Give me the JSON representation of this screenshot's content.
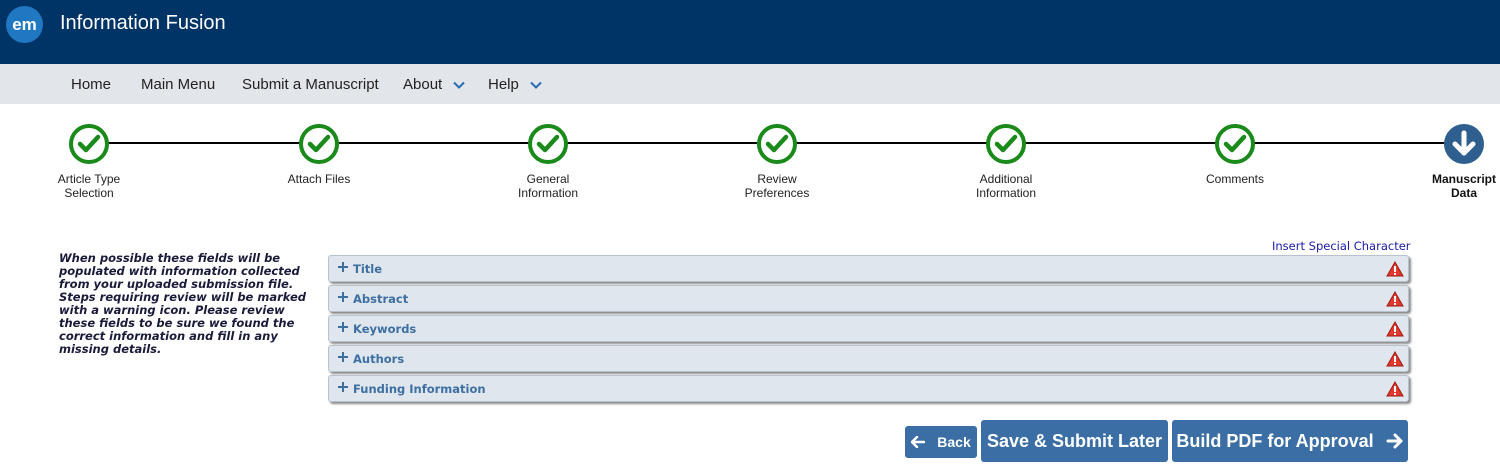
{
  "header": {
    "logo_text": "em",
    "title": "Information Fusion",
    "bg_color": "#003366"
  },
  "nav": {
    "items": [
      {
        "label": "Home",
        "dropdown": false
      },
      {
        "label": "Main Menu",
        "dropdown": false
      },
      {
        "label": "Submit a Manuscript",
        "dropdown": false
      },
      {
        "label": "About",
        "dropdown": true
      },
      {
        "label": "Help",
        "dropdown": true
      }
    ]
  },
  "steps": [
    {
      "line1": "Article Type",
      "line2": "Selection",
      "status": "complete"
    },
    {
      "line1": "Attach Files",
      "line2": "",
      "status": "complete"
    },
    {
      "line1": "General",
      "line2": "Information",
      "status": "complete"
    },
    {
      "line1": "Review",
      "line2": "Preferences",
      "status": "complete"
    },
    {
      "line1": "Additional",
      "line2": "Information",
      "status": "complete"
    },
    {
      "line1": "Comments",
      "line2": "",
      "status": "complete"
    },
    {
      "line1": "Manuscript",
      "line2": "Data",
      "status": "current"
    }
  ],
  "step_colors": {
    "complete": "#1a8a1a",
    "current": "#2f5f8f"
  },
  "special_char_link": "Insert Special Character",
  "help_text": "When possible these fields will be populated with information collected from your uploaded submission file. Steps requiring review will be marked with a warning icon. Please review these fields to be sure we found the correct information and fill in any missing details.",
  "panels": [
    {
      "title": "Title",
      "icon": "warning-icon"
    },
    {
      "title": "Abstract",
      "icon": "warning-icon"
    },
    {
      "title": "Keywords",
      "icon": "warning-icon"
    },
    {
      "title": "Authors",
      "icon": "warning-icon"
    },
    {
      "title": "Funding Information",
      "icon": "warning-icon"
    }
  ],
  "buttons": {
    "back": "Back",
    "save": "Save & Submit Later",
    "build": "Build PDF for Approval"
  }
}
